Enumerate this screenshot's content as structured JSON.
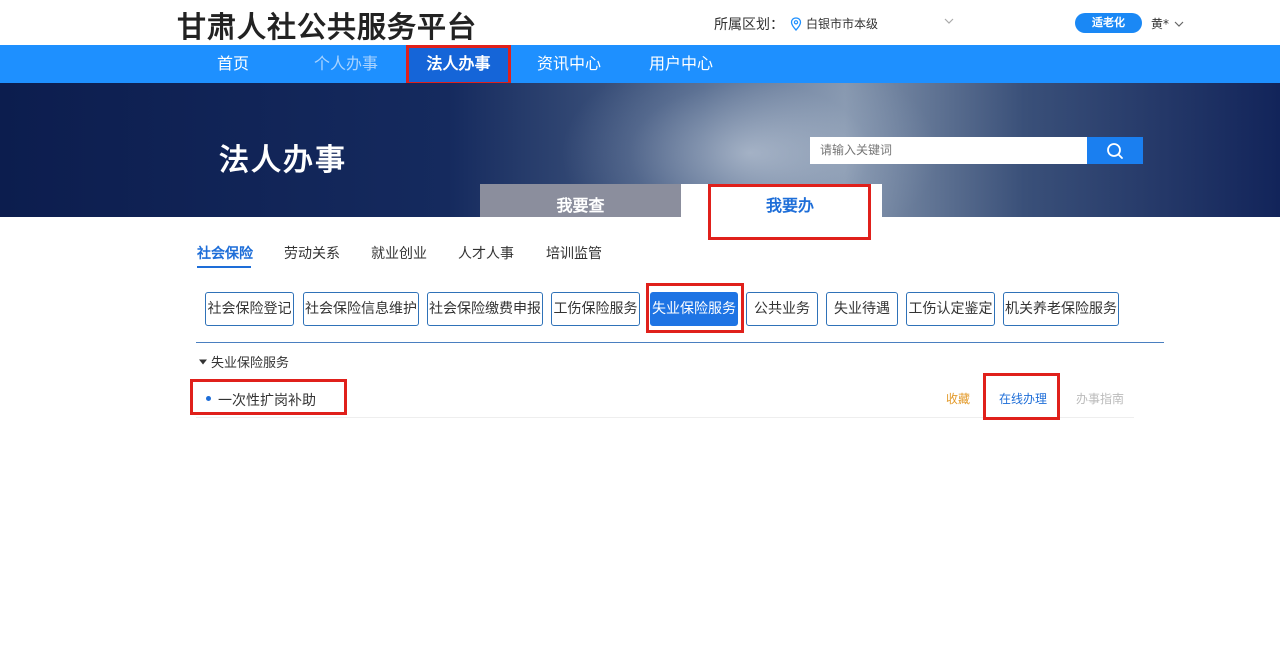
{
  "header": {
    "site_title": "甘肃人社公共服务平台",
    "region_label": "所属区划：",
    "region_value": "白银市市本级",
    "elder_mode": "适老化",
    "user_name": "黄*"
  },
  "nav": {
    "items": [
      {
        "label": "首页"
      },
      {
        "label": "个人办事"
      },
      {
        "label": "法人办事"
      },
      {
        "label": "资讯中心"
      },
      {
        "label": "用户中心"
      }
    ]
  },
  "banner": {
    "title": "法人办事",
    "search_placeholder": "请输入关键词",
    "tab_query": "我要查",
    "tab_do": "我要办"
  },
  "categories": [
    {
      "label": "社会保险"
    },
    {
      "label": "劳动关系"
    },
    {
      "label": "就业创业"
    },
    {
      "label": "人才人事"
    },
    {
      "label": "培训监管"
    }
  ],
  "services": [
    {
      "label": "社会保险登记"
    },
    {
      "label": "社会保险信息维护"
    },
    {
      "label": "社会保险缴费申报"
    },
    {
      "label": "工伤保险服务"
    },
    {
      "label": "失业保险服务"
    },
    {
      "label": "公共业务"
    },
    {
      "label": "失业待遇"
    },
    {
      "label": "工伤认定鉴定"
    },
    {
      "label": "机关养老保险服务"
    }
  ],
  "group": {
    "title": "失业保险服务",
    "items": [
      {
        "name": "一次性扩岗补助",
        "fav": "收藏",
        "online": "在线办理",
        "guide": "办事指南"
      }
    ]
  },
  "colors": {
    "nav_blue": "#1e90ff",
    "accent": "#1e6ed8",
    "highlight_red": "#e0201b"
  }
}
